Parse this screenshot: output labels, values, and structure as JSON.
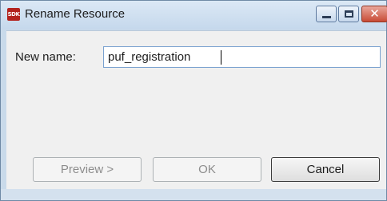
{
  "window": {
    "title": "Rename Resource",
    "icon_label": "SDK",
    "controls": {
      "minimize": "minimize-icon",
      "maximize": "maximize-icon",
      "close": "close-icon"
    }
  },
  "form": {
    "new_name_label": "New name:",
    "new_name_value": "puf_registration"
  },
  "buttons": {
    "preview": "Preview >",
    "ok": "OK",
    "cancel": "Cancel"
  }
}
